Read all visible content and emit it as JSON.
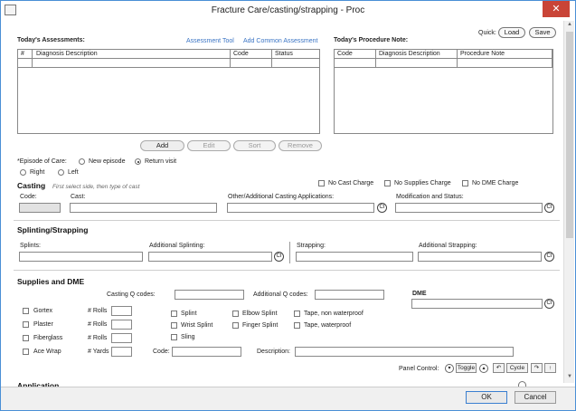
{
  "window": {
    "title": "Fracture Care/casting/strapping - Proc",
    "close": "✕"
  },
  "quick": {
    "label": "Quick:",
    "load": "Load",
    "save": "Save"
  },
  "assessments": {
    "title": "Today's Assessments:",
    "links": [
      "Assessment Tool",
      "Add Common Assessment"
    ],
    "columns": [
      "#",
      "Diagnosis Description",
      "Code",
      "Status"
    ],
    "buttons": [
      {
        "label": "Add",
        "enabled": true
      },
      {
        "label": "Edit",
        "enabled": false
      },
      {
        "label": "Sort",
        "enabled": false
      },
      {
        "label": "Remove",
        "enabled": false
      }
    ]
  },
  "procedure_note": {
    "title": "Today's Procedure Note:",
    "columns": [
      "Code",
      "Diagnosis Description",
      "Procedure Note"
    ]
  },
  "episode": {
    "label": "*Episode of Care:",
    "options": [
      "New episode",
      "Return visit"
    ],
    "selected": "Return visit",
    "side_options": [
      "Right",
      "Left"
    ]
  },
  "casting": {
    "title": "Casting",
    "hint": "First select side, then type of cast",
    "checks": [
      "No Cast Charge",
      "No Supplies Charge",
      "No DME Charge"
    ],
    "fields": {
      "code": "Code:",
      "cast": "Cast:",
      "additional": "Other/Additional Casting Applications:",
      "modification": "Modification and Status:"
    }
  },
  "splinting": {
    "title": "Splinting/Strapping",
    "fields": {
      "splints": "Splints:",
      "additional_splinting": "Additional Splinting:",
      "strapping": "Strapping:",
      "additional_strapping": "Additional Strapping:"
    }
  },
  "supplies": {
    "title": "Supplies and DME",
    "casting_q": "Casting Q codes:",
    "additional_q": "Additional Q codes:",
    "dme": "DME",
    "materials": [
      {
        "name": "Gortex",
        "unit": ""
      },
      {
        "name": "Plaster",
        "unit": "# Rolls"
      },
      {
        "name": "Fiberglass",
        "unit": "# Rolls"
      },
      {
        "name": "Ace Wrap",
        "unit": "# Yards"
      }
    ],
    "first_unit": "# Rolls",
    "splint_checks": [
      "Splint",
      "Wrist Splint",
      "Sling"
    ],
    "elbow_checks": [
      "Elbow Splint",
      "Finger Splint"
    ],
    "tape_checks": [
      "Tape, non waterproof",
      "Tape, waterproof"
    ],
    "code_label": "Code:",
    "description_label": "Description:"
  },
  "panel_control": {
    "label": "Panel Control:",
    "toggle": "Toggle",
    "cycle": "Cycle"
  },
  "ci_label": "CI",
  "footer": {
    "ok": "OK",
    "cancel": "Cancel"
  },
  "next_section_partial": "Application"
}
